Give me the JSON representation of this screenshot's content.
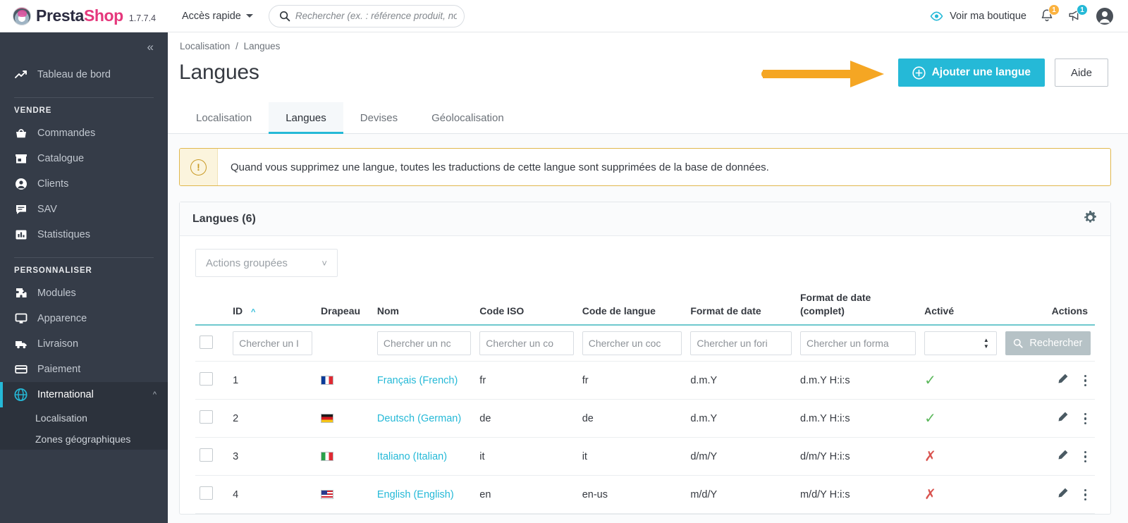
{
  "header": {
    "brand_prefix": "Presta",
    "brand_suffix": "Shop",
    "version": "1.7.7.4",
    "quick_access": "Accès rapide",
    "search_placeholder": "Rechercher (ex. : référence produit, nom",
    "search_value": "",
    "view_shop": "Voir ma boutique",
    "notifications_badge": "1",
    "messages_badge": "1",
    "icons": {
      "search": "search-icon",
      "eye": "eye-icon",
      "bell": "bell-icon",
      "megaphone": "megaphone-icon",
      "avatar": "avatar-icon",
      "caret": "chevron-down-icon"
    },
    "colors": {
      "accent": "#25b9d7",
      "brand_pink": "#e5387c",
      "badge_amber": "#fbb23f"
    }
  },
  "sidebar": {
    "collapse_label": "«",
    "dashboard": "Tableau de bord",
    "sections": [
      {
        "title": "VENDRE",
        "items": [
          {
            "label": "Commandes",
            "icon": "basket-icon"
          },
          {
            "label": "Catalogue",
            "icon": "store-icon"
          },
          {
            "label": "Clients",
            "icon": "user-icon"
          },
          {
            "label": "SAV",
            "icon": "chat-icon"
          },
          {
            "label": "Statistiques",
            "icon": "bar-chart-icon"
          }
        ]
      },
      {
        "title": "PERSONNALISER",
        "items": [
          {
            "label": "Modules",
            "icon": "puzzle-icon"
          },
          {
            "label": "Apparence",
            "icon": "monitor-icon"
          },
          {
            "label": "Livraison",
            "icon": "truck-icon"
          },
          {
            "label": "Paiement",
            "icon": "credit-card-icon"
          },
          {
            "label": "International",
            "icon": "globe-icon",
            "active": true,
            "expanded": true
          }
        ]
      }
    ],
    "sub_items": [
      {
        "label": "Localisation"
      },
      {
        "label": "Zones géographiques"
      }
    ]
  },
  "page": {
    "breadcrumb": {
      "parent": "Localisation",
      "separator": "/",
      "current": "Langues"
    },
    "title": "Langues",
    "add_button": "Ajouter une langue",
    "help_button": "Aide",
    "tabs": [
      {
        "label": "Localisation",
        "active": false
      },
      {
        "label": "Langues",
        "active": true
      },
      {
        "label": "Devises",
        "active": false
      },
      {
        "label": "Géolocalisation",
        "active": false
      }
    ],
    "alert": "Quand vous supprimez une langue, toutes les traductions de cette langue sont supprimées de la base de données."
  },
  "panel": {
    "title": "Langues (6)",
    "gear_icon": "gear-icon",
    "bulk_actions": "Actions groupées"
  },
  "table": {
    "columns": [
      {
        "key": "checkbox",
        "label": ""
      },
      {
        "key": "id",
        "label": "ID",
        "sorted": "asc"
      },
      {
        "key": "flag",
        "label": "Drapeau"
      },
      {
        "key": "name",
        "label": "Nom"
      },
      {
        "key": "iso",
        "label": "Code ISO"
      },
      {
        "key": "lang_code",
        "label": "Code de langue"
      },
      {
        "key": "date_format",
        "label": "Format de date"
      },
      {
        "key": "date_format_full",
        "label": "Format de date (complet)"
      },
      {
        "key": "enabled",
        "label": "Activé"
      },
      {
        "key": "actions",
        "label": "Actions"
      }
    ],
    "filters": {
      "id": "Chercher un I",
      "name": "Chercher un nc",
      "iso": "Chercher un co",
      "lang_code": "Chercher un coc",
      "date_format": "Chercher un fori",
      "date_format_full": "Chercher un forma",
      "enabled_selected": "",
      "search_button": "Rechercher"
    },
    "rows": [
      {
        "id": "1",
        "flag": "flag-fr",
        "flag_name": "france-flag-icon",
        "name": "Français (French)",
        "iso": "fr",
        "lang_code": "fr",
        "date_format": "d.m.Y",
        "date_format_full": "d.m.Y H:i:s",
        "enabled": true
      },
      {
        "id": "2",
        "flag": "flag-de",
        "flag_name": "germany-flag-icon",
        "name": "Deutsch (German)",
        "iso": "de",
        "lang_code": "de",
        "date_format": "d.m.Y",
        "date_format_full": "d.m.Y H:i:s",
        "enabled": true
      },
      {
        "id": "3",
        "flag": "flag-it",
        "flag_name": "italy-flag-icon",
        "name": "Italiano (Italian)",
        "iso": "it",
        "lang_code": "it",
        "date_format": "d/m/Y",
        "date_format_full": "d/m/Y H:i:s",
        "enabled": false
      },
      {
        "id": "4",
        "flag": "flag-us",
        "flag_name": "usa-flag-icon",
        "name": "English (English)",
        "iso": "en",
        "lang_code": "en-us",
        "date_format": "m/d/Y",
        "date_format_full": "m/d/Y H:i:s",
        "enabled": false
      }
    ]
  },
  "annotation": {
    "arrow_color": "#f5a623",
    "points_to": "Ajouter une langue"
  }
}
